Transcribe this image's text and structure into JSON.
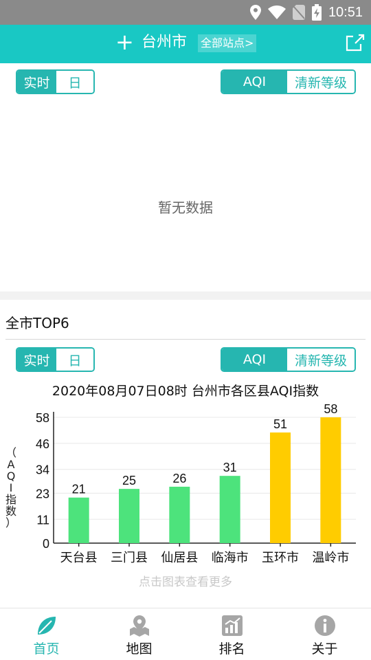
{
  "status_bar": {
    "time": "10:51"
  },
  "header": {
    "add_icon": "+",
    "city": "台州市",
    "all_sites_label": "全部站点>"
  },
  "top_section": {
    "time_toggle": [
      "实时",
      "日"
    ],
    "index_toggle": [
      "AQI",
      "清新等级"
    ],
    "empty_text": "暂无数据"
  },
  "ranking_section": {
    "title": "全市TOP6",
    "time_toggle": [
      "实时",
      "日"
    ],
    "index_toggle": [
      "AQI",
      "清新等级"
    ],
    "hint": "点击图表查看更多"
  },
  "chart_data": {
    "type": "bar",
    "title": "2020年08月07日08时 台州市各区县AQI指数",
    "ylabel": "（AQI指数）",
    "ylabel_chars": [
      "（",
      "A",
      "Q",
      "I",
      "指",
      "数",
      "）"
    ],
    "categories": [
      "天台县",
      "三门县",
      "仙居县",
      "临海市",
      "玉环市",
      "温岭市"
    ],
    "values": [
      21,
      25,
      26,
      31,
      51,
      58
    ],
    "value_labels": [
      "21",
      "25",
      "26",
      "31",
      "51",
      "58"
    ],
    "colors": [
      "#4de37c",
      "#4de37c",
      "#4de37c",
      "#4de37c",
      "#ffcc00",
      "#ffcc00"
    ],
    "yticks": [
      "0",
      "11",
      "23",
      "34",
      "46",
      "58"
    ],
    "ylim": [
      0,
      58
    ],
    "grid": true
  },
  "nav": [
    {
      "label": "首页",
      "icon": "leaf-icon",
      "active": true
    },
    {
      "label": "地图",
      "icon": "map-pin-icon",
      "active": false
    },
    {
      "label": "排名",
      "icon": "ranking-chart-icon",
      "active": false
    },
    {
      "label": "关于",
      "icon": "info-icon",
      "active": false
    }
  ],
  "colors": {
    "accent": "#26b6b0",
    "header": "#19c8c4",
    "good": "#4de37c",
    "moderate": "#ffcc00"
  }
}
